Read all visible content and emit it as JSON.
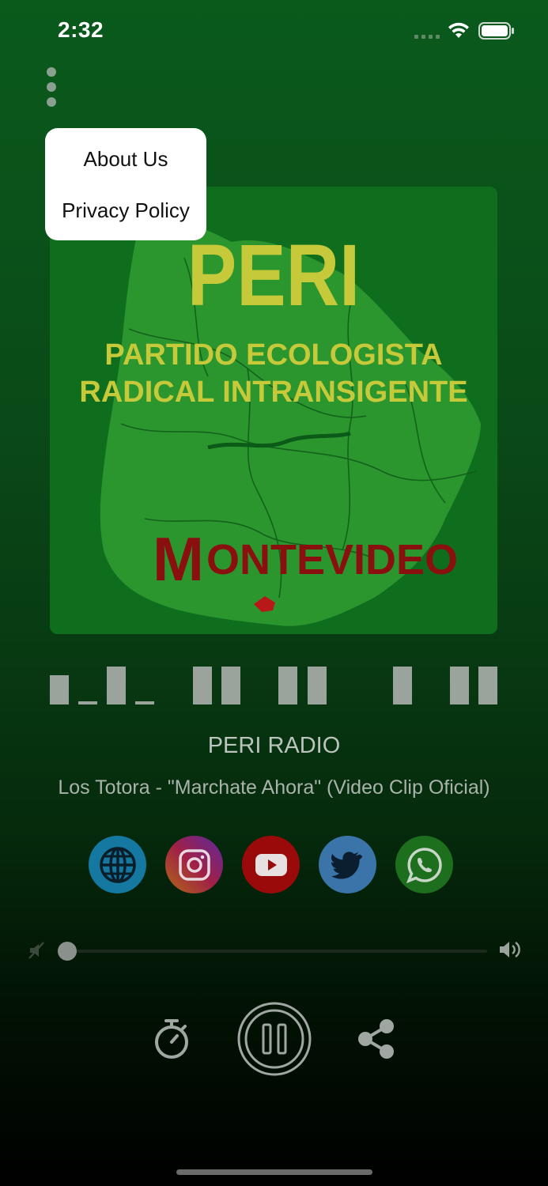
{
  "status_bar": {
    "time": "2:32"
  },
  "menu": {
    "items": [
      "About Us",
      "Privacy Policy"
    ]
  },
  "artwork": {
    "title": "PERI",
    "subtitle_line1": "PARTIDO ECOLOGISTA",
    "subtitle_line2": "RADICAL INTRANSIGENTE",
    "city_initial": "M",
    "city_rest": "ONTEVIDEO"
  },
  "player": {
    "station_name": "PERI RADIO",
    "track_title": "Los Totora - \"Marchate Ahora\" (Video Clip Oficial)",
    "volume_level": 0.0
  },
  "social": [
    {
      "name": "website",
      "icon": "globe-icon",
      "color": "#1478a0"
    },
    {
      "name": "instagram",
      "icon": "instagram-icon",
      "color": "#b0306a"
    },
    {
      "name": "youtube",
      "icon": "youtube-icon",
      "color": "#9a0a0a"
    },
    {
      "name": "twitter",
      "icon": "twitter-icon",
      "color": "#3a74a8"
    },
    {
      "name": "whatsapp",
      "icon": "whatsapp-icon",
      "color": "#1d6e1d"
    }
  ],
  "colors": {
    "accent_green": "#0a5a1c",
    "artwork_title_yellow": "#c6c93a",
    "artwork_city_red": "#8a0f0f"
  }
}
